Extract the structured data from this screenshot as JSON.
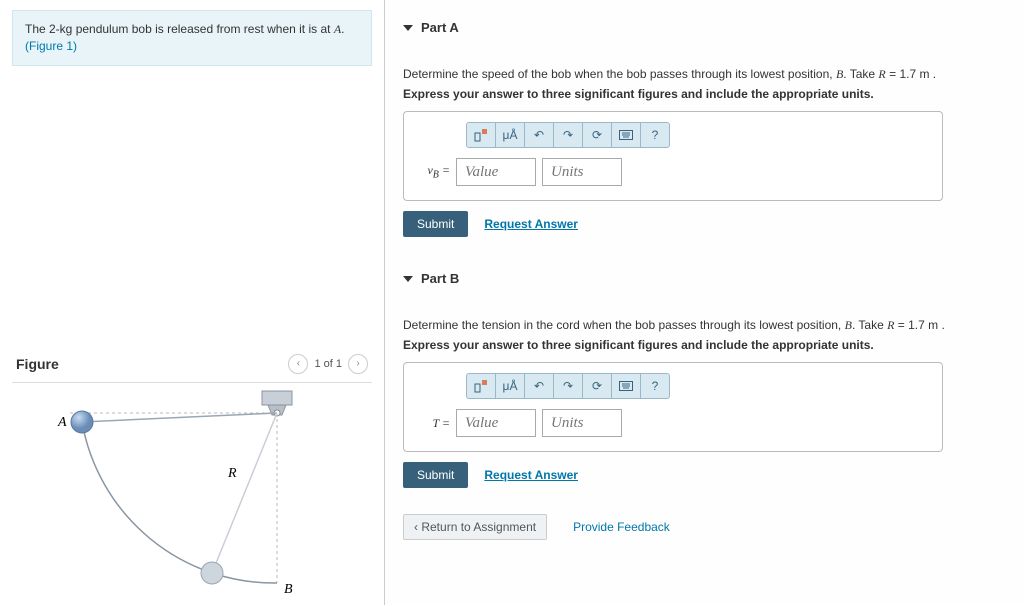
{
  "problem": {
    "text_pre": "The 2-kg pendulum bob is released from rest when it is at ",
    "point": "A",
    "text_post": ".",
    "figure_link": "(Figure 1)"
  },
  "figure": {
    "title": "Figure",
    "pager": "1 of 1",
    "label_A": "A",
    "label_B": "B",
    "label_R": "R"
  },
  "partA": {
    "title": "Part A",
    "instr_pre": "Determine the speed of the bob when the bob passes through its lowest position, ",
    "instr_point": "B",
    "instr_mid": ". Take ",
    "instr_var": "R",
    "instr_val": " = 1.7 m .",
    "sigfig": "Express your answer to three significant figures and include the appropriate units.",
    "var_label": "vB =",
    "value_ph": "Value",
    "units_ph": "Units",
    "submit": "Submit",
    "request": "Request Answer",
    "tb_mu": "μÅ"
  },
  "partB": {
    "title": "Part B",
    "instr_pre": "Determine the tension in the cord when the bob passes through its lowest position, ",
    "instr_point": "B",
    "instr_mid": ". Take ",
    "instr_var": "R",
    "instr_val": " = 1.7 m .",
    "sigfig": "Express your answer to three significant figures and include the appropriate units.",
    "var_label": "T =",
    "value_ph": "Value",
    "units_ph": "Units",
    "submit": "Submit",
    "request": "Request Answer",
    "tb_mu": "μÅ"
  },
  "bottom": {
    "return": "Return to Assignment",
    "feedback": "Provide Feedback"
  },
  "icons": {
    "help": "?"
  }
}
